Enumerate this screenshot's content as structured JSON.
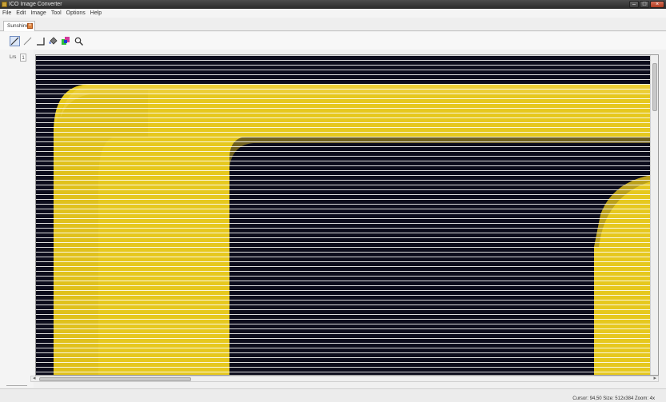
{
  "window": {
    "title": "ICO Image Converter"
  },
  "menu": {
    "items": [
      "File",
      "Edit",
      "Image",
      "Tool",
      "Options",
      "Help"
    ]
  },
  "tabs": [
    {
      "label": "Sunshine"
    }
  ],
  "toolbar": {
    "tools": [
      {
        "icon": "pencil-icon",
        "active": true
      },
      {
        "icon": "line-icon",
        "active": false
      },
      {
        "icon": "rectangle-icon",
        "active": false
      },
      {
        "icon": "fill-bucket-icon",
        "active": false
      },
      {
        "icon": "color-picker-icon",
        "active": false
      },
      {
        "icon": "zoom-icon",
        "active": false
      }
    ]
  },
  "left_panel": {
    "tab_a": "Lrs",
    "tab_b": "1"
  },
  "status": {
    "text": "Cursor: 94,50 Size: 512x384 Zoom: 4x"
  },
  "colors": {
    "yellow": "#e6c81e",
    "dark": "#0a0a14",
    "accent": "#6f8bbf"
  }
}
